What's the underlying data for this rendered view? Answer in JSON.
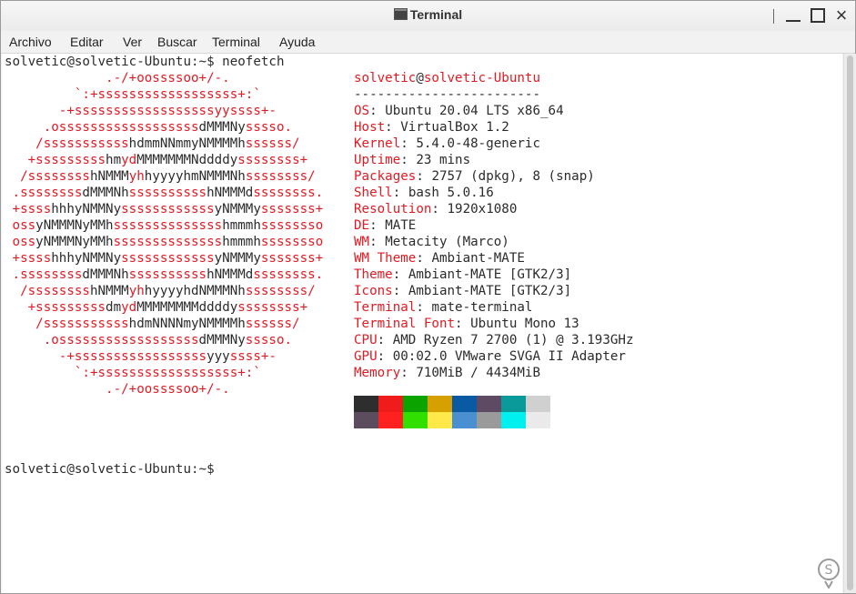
{
  "window": {
    "title": "Terminal",
    "controls": {
      "minimize": "minimize",
      "maximize": "maximize",
      "close": "×"
    }
  },
  "menu": [
    "Archivo",
    "Editar",
    "Ver",
    "Buscar",
    "Terminal",
    "Ayuda"
  ],
  "prompt_command": "solvetic@solvetic-Ubuntu:~$ neofetch",
  "logo_lines": [
    [
      [
        "r",
        "             .-/+oossssoo+/-.              "
      ]
    ],
    [
      [
        "r",
        "         `:+ssssssssssssssssss+:`          "
      ]
    ],
    [
      [
        "r",
        "       -+ssssssssssssssssssyyssss+-        "
      ]
    ],
    [
      [
        "r",
        "     .ossssssssssssssssss"
      ],
      [
        "w",
        "dMMMNy"
      ],
      [
        "r",
        "sssso.      "
      ]
    ],
    [
      [
        "r",
        "    /sssssssssss"
      ],
      [
        "w",
        "hdmmNNmmyNMMMMh"
      ],
      [
        "r",
        "ssssss/     "
      ]
    ],
    [
      [
        "r",
        "   +sssssssss"
      ],
      [
        "w",
        "hm"
      ],
      [
        "r",
        "yd"
      ],
      [
        "w",
        "MMMMMMMNddddy"
      ],
      [
        "r",
        "ssssssss+   "
      ]
    ],
    [
      [
        "r",
        "  /ssssssss"
      ],
      [
        "w",
        "hNMMM"
      ],
      [
        "r",
        "yh"
      ],
      [
        "w",
        "hyyyyhmNMMMNh"
      ],
      [
        "r",
        "ssssssss/  "
      ]
    ],
    [
      [
        "r",
        " .ssssssss"
      ],
      [
        "w",
        "dMMMNh"
      ],
      [
        "r",
        "ssssssssss"
      ],
      [
        "w",
        "hNMMMd"
      ],
      [
        "r",
        "ssssssss. "
      ]
    ],
    [
      [
        "r",
        " +ssss"
      ],
      [
        "w",
        "hhhyNMMNy"
      ],
      [
        "r",
        "ssssssssssss"
      ],
      [
        "w",
        "yNMMMy"
      ],
      [
        "r",
        "sssssss+ "
      ]
    ],
    [
      [
        "r",
        " oss"
      ],
      [
        "w",
        "yNMMMNyMMh"
      ],
      [
        "r",
        "ssssssssssssss"
      ],
      [
        "w",
        "hmmmh"
      ],
      [
        "r",
        "ssssssso "
      ]
    ],
    [
      [
        "r",
        " oss"
      ],
      [
        "w",
        "yNMMMNyMMh"
      ],
      [
        "r",
        "ssssssssssssss"
      ],
      [
        "w",
        "hmmmh"
      ],
      [
        "r",
        "ssssssso "
      ]
    ],
    [
      [
        "r",
        " +ssss"
      ],
      [
        "w",
        "hhhyNMMNy"
      ],
      [
        "r",
        "ssssssssssss"
      ],
      [
        "w",
        "yNMMMy"
      ],
      [
        "r",
        "sssssss+ "
      ]
    ],
    [
      [
        "r",
        " .ssssssss"
      ],
      [
        "w",
        "dMMMNh"
      ],
      [
        "r",
        "ssssssssss"
      ],
      [
        "w",
        "hNMMMd"
      ],
      [
        "r",
        "ssssssss. "
      ]
    ],
    [
      [
        "r",
        "  /ssssssss"
      ],
      [
        "w",
        "hNMMM"
      ],
      [
        "r",
        "yh"
      ],
      [
        "w",
        "hyyyyhdNMMMNh"
      ],
      [
        "r",
        "ssssssss/  "
      ]
    ],
    [
      [
        "r",
        "   +sssssssss"
      ],
      [
        "w",
        "dm"
      ],
      [
        "r",
        "yd"
      ],
      [
        "w",
        "MMMMMMMMddddy"
      ],
      [
        "r",
        "ssssssss+   "
      ]
    ],
    [
      [
        "r",
        "    /sssssssssss"
      ],
      [
        "w",
        "hdmNNNNmyNMMMMh"
      ],
      [
        "r",
        "ssssss/     "
      ]
    ],
    [
      [
        "r",
        "     .ossssssssssssssssss"
      ],
      [
        "w",
        "dMMMNy"
      ],
      [
        "r",
        "sssso.      "
      ]
    ],
    [
      [
        "r",
        "       -+sssssssssssssssss"
      ],
      [
        "w",
        "yyy"
      ],
      [
        "r",
        "ssss+-        "
      ]
    ],
    [
      [
        "r",
        "         `:+ssssssssssssssssss+:`          "
      ]
    ],
    [
      [
        "r",
        "             .-/+oossssoo+/-.              "
      ]
    ]
  ],
  "header": {
    "user": "solvetic",
    "at": "@",
    "host": "solvetic-Ubuntu",
    "rule": "------------------------"
  },
  "info": [
    {
      "key": "OS",
      "value": "Ubuntu 20.04 LTS x86_64"
    },
    {
      "key": "Host",
      "value": "VirtualBox 1.2"
    },
    {
      "key": "Kernel",
      "value": "5.4.0-48-generic"
    },
    {
      "key": "Uptime",
      "value": "23 mins"
    },
    {
      "key": "Packages",
      "value": "2757 (dpkg), 8 (snap)"
    },
    {
      "key": "Shell",
      "value": "bash 5.0.16"
    },
    {
      "key": "Resolution",
      "value": "1920x1080"
    },
    {
      "key": "DE",
      "value": "MATE"
    },
    {
      "key": "WM",
      "value": "Metacity (Marco)"
    },
    {
      "key": "WM Theme",
      "value": "Ambiant-MATE"
    },
    {
      "key": "Theme",
      "value": "Ambiant-MATE [GTK2/3]"
    },
    {
      "key": "Icons",
      "value": "Ambiant-MATE [GTK2/3]"
    },
    {
      "key": "Terminal",
      "value": "mate-terminal"
    },
    {
      "key": "Terminal Font",
      "value": "Ubuntu Mono 13"
    },
    {
      "key": "CPU",
      "value": "AMD Ryzen 7 2700 (1) @ 3.193GHz"
    },
    {
      "key": "GPU",
      "value": "00:02.0 VMware SVGA II Adapter"
    },
    {
      "key": "Memory",
      "value": "710MiB / 4434MiB"
    }
  ],
  "palette_top": [
    "#2e2e2e",
    "#f01c1c",
    "#0aa300",
    "#d6a100",
    "#0a5aa3",
    "#5e4a63",
    "#0a9a9a",
    "#d0d0d0"
  ],
  "palette_bottom": [
    "#5c4d5e",
    "#ff2020",
    "#32e000",
    "#ffe84a",
    "#4a8fd0",
    "#9a9a9a",
    "#00f0f0",
    "#eaeaea"
  ],
  "prompt": "solvetic@solvetic-Ubuntu:~$"
}
